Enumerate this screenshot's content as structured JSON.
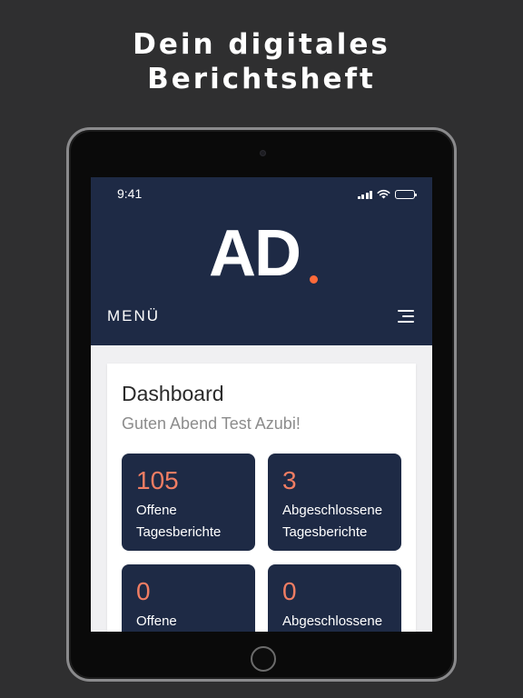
{
  "headline": {
    "line1": "Dein digitales",
    "line2": "Berichtsheft"
  },
  "status_bar": {
    "time": "9:41",
    "icons": [
      "signal-icon",
      "wifi-icon",
      "battery-icon"
    ]
  },
  "app": {
    "logo_text": "AD",
    "menu_label": "MENÜ",
    "menu_icon": "hamburger-icon"
  },
  "dashboard": {
    "title": "Dashboard",
    "greeting": "Guten Abend Test Azubi!",
    "tiles": [
      {
        "number": "105",
        "label_line1": "Offene",
        "label_line2": "Tagesberichte"
      },
      {
        "number": "3",
        "label_line1": "Abgeschlossene",
        "label_line2": "Tagesberichte"
      },
      {
        "number": "0",
        "label_line1": "Offene",
        "label_line2": ""
      },
      {
        "number": "0",
        "label_line1": "Abgeschlossene",
        "label_line2": ""
      }
    ]
  },
  "colors": {
    "background": "#2f2f30",
    "navy": "#1e2a45",
    "accent_orange": "#ff6a3a",
    "tile_number": "#f07d63"
  }
}
